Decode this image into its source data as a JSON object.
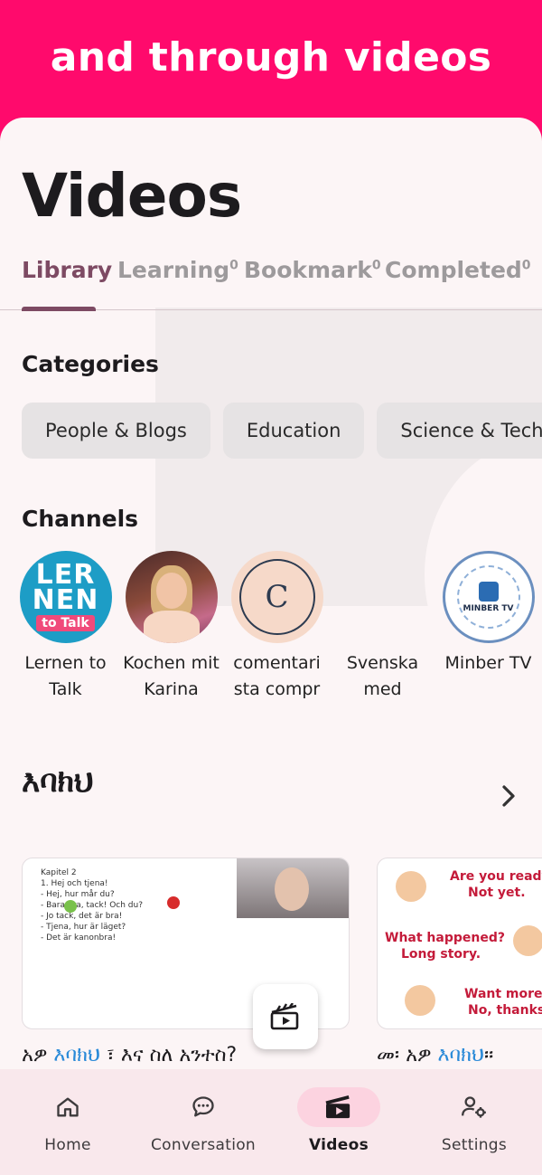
{
  "banner": {
    "text": "and through videos"
  },
  "page": {
    "title": "Videos"
  },
  "tabs": [
    {
      "label": "Library",
      "count": ""
    },
    {
      "label": "Learning",
      "count": "0"
    },
    {
      "label": "Bookmark",
      "count": "0"
    },
    {
      "label": "Completed",
      "count": "0"
    }
  ],
  "categories": {
    "title": "Categories",
    "items": [
      "People & Blogs",
      "Education",
      "Science & Tech"
    ]
  },
  "channels": {
    "title": "Channels",
    "items": [
      {
        "name": "Lernen to Talk",
        "logo_text_1": "LER",
        "logo_text_2": "NEN",
        "logo_text_3": "to Talk"
      },
      {
        "name": "Kochen mit Karina"
      },
      {
        "name": "comentari sta compr",
        "logo_letter": "C"
      },
      {
        "name": "Svenska med"
      },
      {
        "name": "Minber TV",
        "logo_text": "MINBER TV"
      }
    ]
  },
  "playlist": {
    "title": "እባክህ",
    "videos": [
      {
        "title_pre": "አዎ ",
        "title_kw": "እባክህ",
        "title_post": " ፣ እና ስለ አንተስ?",
        "thumb_lines": "Kapitel 2\n1. Hej och tjena!\n- Hej, hur mår du?\n- Bara bra, tack! Och du?\n- Jo tack, det är bra!\n- Tjena, hur är läget?\n- Det är kanonbra!"
      },
      {
        "title_pre": "መ፡ አዎ ",
        "title_kw": "እባክህ",
        "title_post": "።",
        "thumb_texts": [
          "Are you ready?",
          "Not yet.",
          "What happened?",
          "Long story.",
          "Want more?",
          "No, thanks."
        ]
      }
    ]
  },
  "nav": [
    {
      "label": "Home",
      "icon": "home-icon"
    },
    {
      "label": "Conversation",
      "icon": "chat-icon"
    },
    {
      "label": "Videos",
      "icon": "clapperboard-icon",
      "active": true
    },
    {
      "label": "Settings",
      "icon": "user-settings-icon"
    }
  ],
  "colors": {
    "banner": "#ff0a6c",
    "accent": "#7d4a63",
    "nav_active": "#fcd3e0",
    "keyword": "#2a8ad8"
  }
}
